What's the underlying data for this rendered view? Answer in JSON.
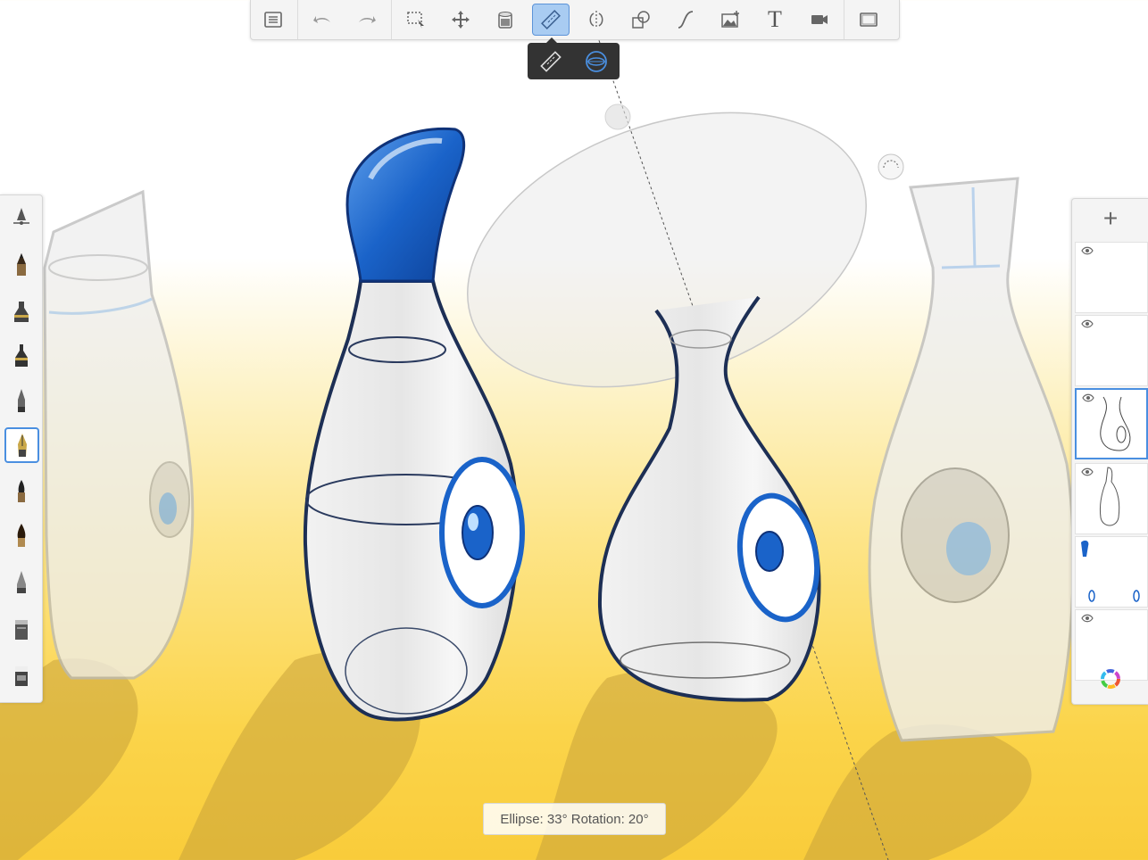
{
  "toolbar": {
    "items": [
      {
        "name": "layer-list-icon"
      },
      {
        "name": "undo-icon"
      },
      {
        "name": "redo-icon"
      },
      {
        "name": "selection-icon"
      },
      {
        "name": "transform-icon"
      },
      {
        "name": "fill-bucket-icon"
      },
      {
        "name": "ruler-icon",
        "active": true
      },
      {
        "name": "symmetry-icon"
      },
      {
        "name": "shapes-icon"
      },
      {
        "name": "curve-icon"
      },
      {
        "name": "image-import-icon"
      },
      {
        "name": "text-icon",
        "label": "T"
      },
      {
        "name": "record-video-icon"
      },
      {
        "name": "fullscreen-icon"
      }
    ]
  },
  "guide_tools": {
    "ruler": {
      "name": "ruler-guide-icon"
    },
    "ellipse": {
      "name": "ellipse-guide-icon",
      "active": true
    }
  },
  "brushes": {
    "items": [
      "airbrush",
      "pencil",
      "marker",
      "felt-tip",
      "ballpoint",
      "fine-nib",
      "brush",
      "paintbrush",
      "chisel",
      "smudge",
      "eraser"
    ],
    "active_index": 5
  },
  "layers": {
    "add_label": "+",
    "count": 6,
    "active_index": 2
  },
  "status": {
    "text": "Ellipse: 33°  Rotation: 20°"
  },
  "colors": {
    "accent": "#4a8fe0",
    "blue_paint": "#1a63c9",
    "ink": "#1d2f55",
    "yellow": "#fbd44a",
    "shadow": "#c9a33a"
  }
}
